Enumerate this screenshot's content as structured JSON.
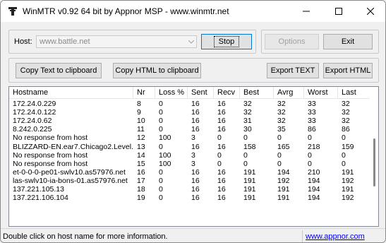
{
  "window": {
    "title": "WinMTR v0.92 64 bit by Appnor MSP - www.winmtr.net"
  },
  "host": {
    "label": "Host:",
    "value": "www.battle.net"
  },
  "buttons": {
    "stop": "Stop",
    "options": "Options",
    "exit": "Exit",
    "copy_text": "Copy Text to clipboard",
    "copy_html": "Copy HTML to clipboard",
    "export_text": "Export TEXT",
    "export_html": "Export HTML"
  },
  "table": {
    "columns": [
      "Hostname",
      "Nr",
      "Loss %",
      "Sent",
      "Recv",
      "Best",
      "Avrg",
      "Worst",
      "Last"
    ],
    "rows": [
      [
        "172.24.0.229",
        "8",
        "0",
        "16",
        "16",
        "32",
        "32",
        "33",
        "32"
      ],
      [
        "172.24.0.122",
        "9",
        "0",
        "16",
        "16",
        "32",
        "32",
        "33",
        "32"
      ],
      [
        "172.24.0.62",
        "10",
        "0",
        "16",
        "16",
        "31",
        "32",
        "33",
        "32"
      ],
      [
        "8.242.0.225",
        "11",
        "0",
        "16",
        "16",
        "30",
        "35",
        "86",
        "86"
      ],
      [
        "No response from host",
        "12",
        "100",
        "3",
        "0",
        "0",
        "0",
        "0",
        "0"
      ],
      [
        "BLIZZARD-EN.ear7.Chicago2.Level...",
        "13",
        "0",
        "16",
        "16",
        "158",
        "165",
        "218",
        "159"
      ],
      [
        "No response from host",
        "14",
        "100",
        "3",
        "0",
        "0",
        "0",
        "0",
        "0"
      ],
      [
        "No response from host",
        "15",
        "100",
        "3",
        "0",
        "0",
        "0",
        "0",
        "0"
      ],
      [
        "et-0-0-0-pe01-swlv10.as57976.net",
        "16",
        "0",
        "16",
        "16",
        "191",
        "194",
        "210",
        "191"
      ],
      [
        "las-swlv10-ia-bons-01.as57976.net",
        "17",
        "0",
        "16",
        "16",
        "191",
        "192",
        "194",
        "192"
      ],
      [
        "137.221.105.13",
        "18",
        "0",
        "16",
        "16",
        "191",
        "191",
        "194",
        "191"
      ],
      [
        "137.221.106.104",
        "19",
        "0",
        "16",
        "16",
        "191",
        "191",
        "194",
        "192"
      ]
    ]
  },
  "status": {
    "text": "Double click on host name for more information.",
    "link": "www.appnor.com"
  }
}
